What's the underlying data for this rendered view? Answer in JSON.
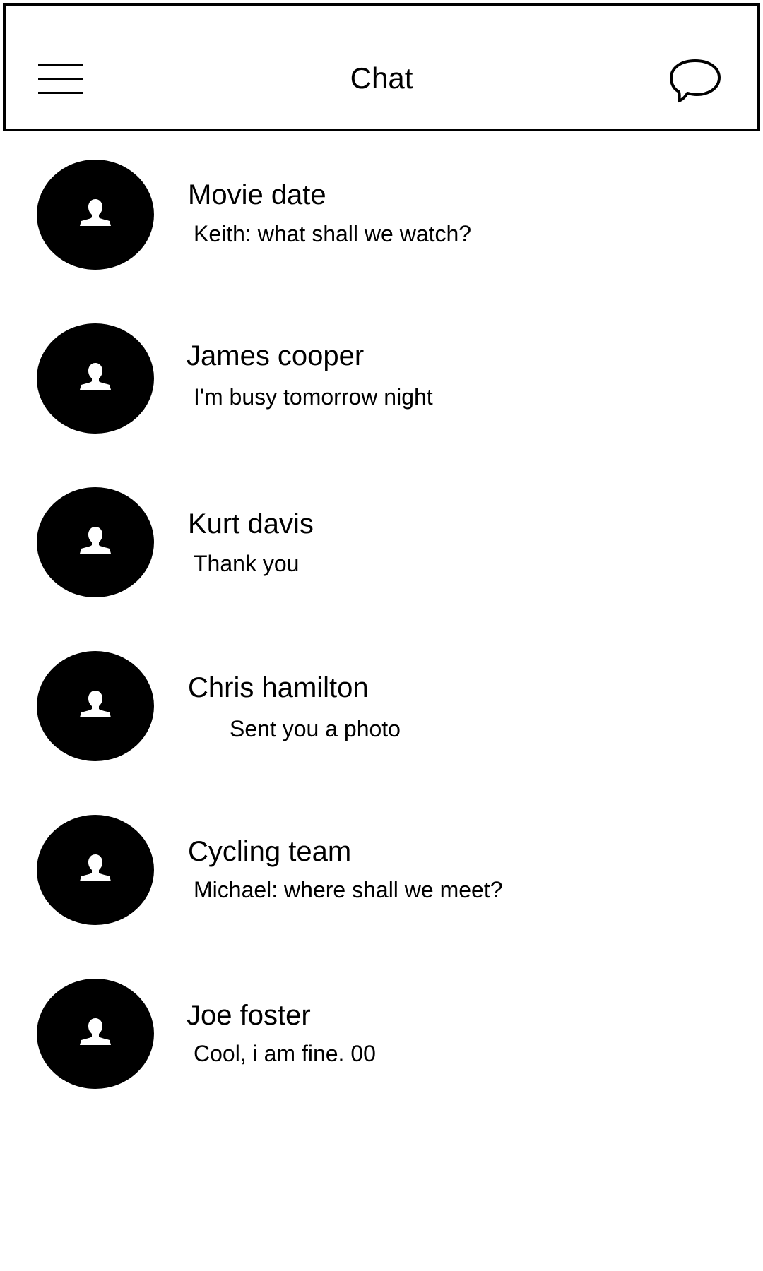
{
  "header": {
    "title": "Chat",
    "menu_icon": "hamburger-menu-icon",
    "compose_icon": "speech-bubble-icon"
  },
  "chats": [
    {
      "name": "Movie date",
      "preview": "Keith: what shall we watch?"
    },
    {
      "name": "James cooper",
      "preview": "I'm busy tomorrow night"
    },
    {
      "name": "Kurt davis",
      "preview": "Thank you"
    },
    {
      "name": "Chris hamilton",
      "preview": "Sent you a photo"
    },
    {
      "name": "Cycling team",
      "preview": "Michael: where shall we meet?"
    },
    {
      "name": "Joe foster",
      "preview": "Cool, i am fine. 00"
    }
  ],
  "colors": {
    "foreground": "#000000",
    "background": "#ffffff"
  }
}
